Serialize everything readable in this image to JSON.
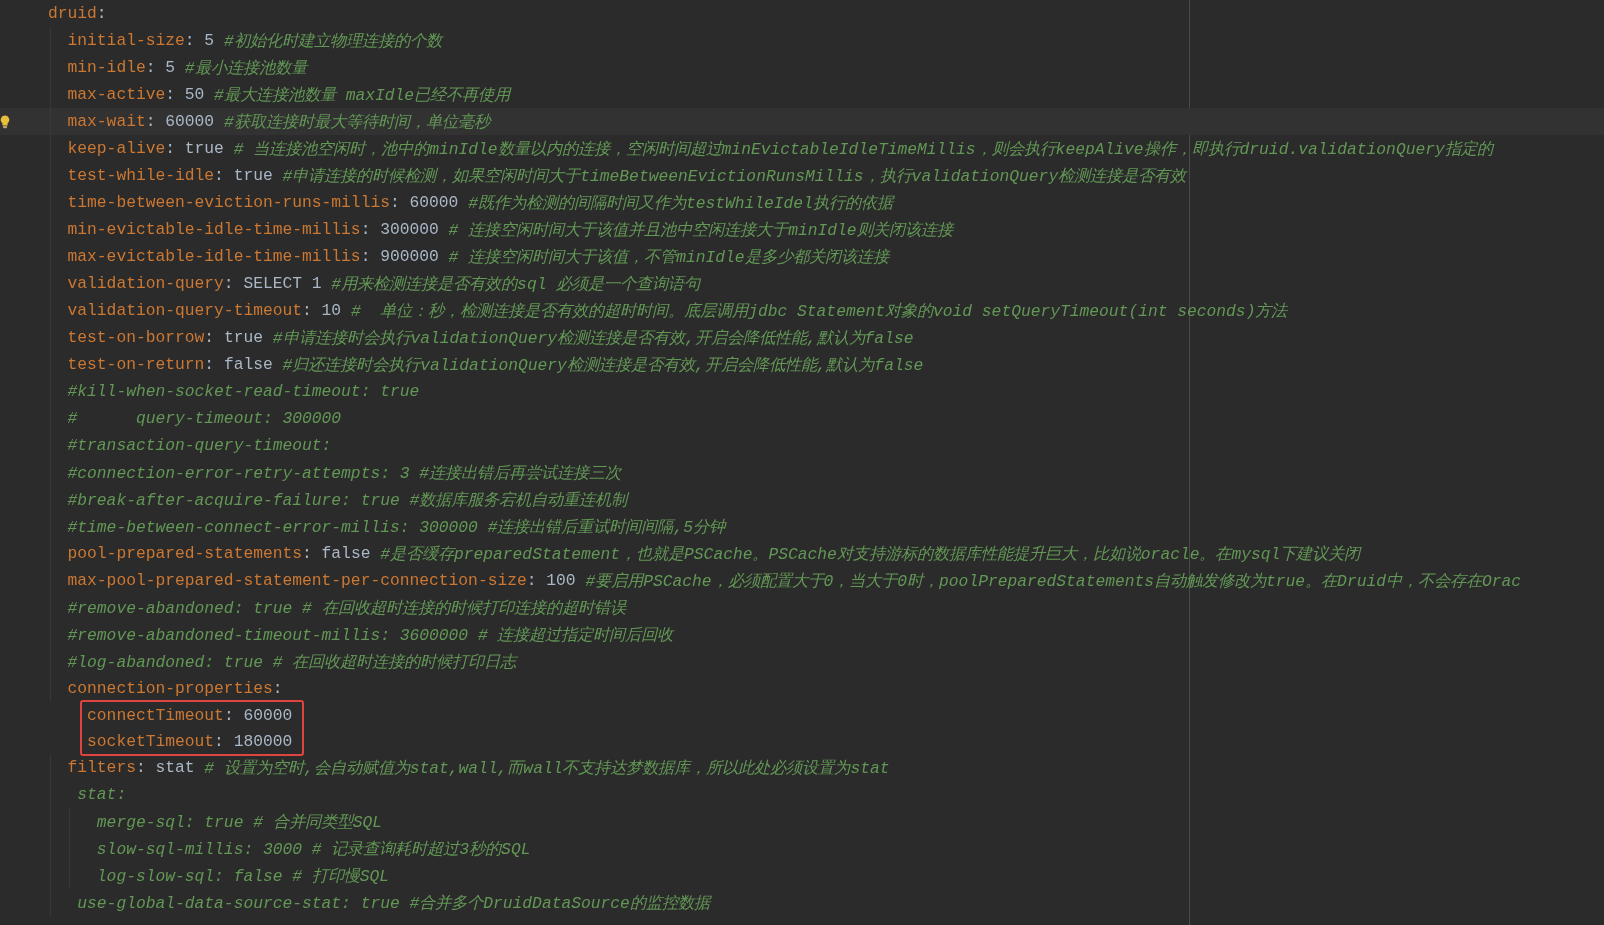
{
  "editor": {
    "lines": [
      {
        "current": false,
        "hint": false,
        "tokens": [
          {
            "kind": "key",
            "text": "druid"
          },
          {
            "kind": "colon",
            "text": ":"
          }
        ],
        "children_boxed": false,
        "children": [
          {
            "current": false,
            "hint": false,
            "tokens": [
              {
                "kind": "key",
                "text": "initial-size"
              },
              {
                "kind": "colon",
                "text": ":"
              },
              {
                "kind": "value",
                "text": "5"
              },
              {
                "kind": "comment",
                "text": "#初始化时建立物理连接的个数"
              }
            ]
          },
          {
            "current": false,
            "hint": false,
            "tokens": [
              {
                "kind": "key",
                "text": "min-idle"
              },
              {
                "kind": "colon",
                "text": ":"
              },
              {
                "kind": "value",
                "text": "5"
              },
              {
                "kind": "comment",
                "text": "#最小连接池数量"
              }
            ]
          },
          {
            "current": false,
            "hint": false,
            "tokens": [
              {
                "kind": "key",
                "text": "max-active"
              },
              {
                "kind": "colon",
                "text": ":"
              },
              {
                "kind": "value",
                "text": "50"
              },
              {
                "kind": "comment",
                "text": "#最大连接池数量 maxIdle已经不再使用"
              }
            ]
          },
          {
            "current": true,
            "hint": true,
            "tokens": [
              {
                "kind": "key",
                "text": "max-wait"
              },
              {
                "kind": "colon",
                "text": ":"
              },
              {
                "kind": "value",
                "text": "60000"
              },
              {
                "kind": "comment",
                "text": "#获取连接时最大等待时间，单位毫秒"
              }
            ]
          },
          {
            "current": false,
            "hint": false,
            "tokens": [
              {
                "kind": "key",
                "text": "keep-alive"
              },
              {
                "kind": "colon",
                "text": ":"
              },
              {
                "kind": "value",
                "text": "true"
              },
              {
                "kind": "comment",
                "text": "# 当连接池空闲时，池中的minIdle数量以内的连接，空闲时间超过minEvictableIdleTimeMillis，则会执行keepAlive操作，即执行druid.validationQuery指定的"
              }
            ]
          },
          {
            "current": false,
            "hint": false,
            "tokens": [
              {
                "kind": "key",
                "text": "test-while-idle"
              },
              {
                "kind": "colon",
                "text": ":"
              },
              {
                "kind": "value",
                "text": "true"
              },
              {
                "kind": "comment",
                "text": "#申请连接的时候检测，如果空闲时间大于timeBetweenEvictionRunsMillis，执行validationQuery检测连接是否有效"
              }
            ]
          },
          {
            "current": false,
            "hint": false,
            "tokens": [
              {
                "kind": "key",
                "text": "time-between-eviction-runs-millis"
              },
              {
                "kind": "colon",
                "text": ":"
              },
              {
                "kind": "value",
                "text": "60000"
              },
              {
                "kind": "comment",
                "text": "#既作为检测的间隔时间又作为testWhileIdel执行的依据"
              }
            ]
          },
          {
            "current": false,
            "hint": false,
            "tokens": [
              {
                "kind": "key",
                "text": "min-evictable-idle-time-millis"
              },
              {
                "kind": "colon",
                "text": ":"
              },
              {
                "kind": "value",
                "text": "300000"
              },
              {
                "kind": "comment",
                "text": "# 连接空闲时间大于该值并且池中空闲连接大于minIdle则关闭该连接"
              }
            ]
          },
          {
            "current": false,
            "hint": false,
            "tokens": [
              {
                "kind": "key",
                "text": "max-evictable-idle-time-millis"
              },
              {
                "kind": "colon",
                "text": ":"
              },
              {
                "kind": "value",
                "text": "900000"
              },
              {
                "kind": "comment",
                "text": "# 连接空闲时间大于该值，不管minIdle是多少都关闭该连接"
              }
            ]
          },
          {
            "current": false,
            "hint": false,
            "tokens": [
              {
                "kind": "key",
                "text": "validation-query"
              },
              {
                "kind": "colon",
                "text": ":"
              },
              {
                "kind": "value",
                "text": "SELECT 1"
              },
              {
                "kind": "comment",
                "text": "#用来检测连接是否有效的sql 必须是一个查询语句"
              }
            ]
          },
          {
            "current": false,
            "hint": false,
            "tokens": [
              {
                "kind": "key",
                "text": "validation-query-timeout"
              },
              {
                "kind": "colon",
                "text": ":"
              },
              {
                "kind": "value",
                "text": "10"
              },
              {
                "kind": "comment",
                "text": "#  单位：秒，检测连接是否有效的超时时间。底层调用jdbc Statement对象的void setQueryTimeout(int seconds)方法"
              }
            ]
          },
          {
            "current": false,
            "hint": false,
            "tokens": [
              {
                "kind": "key",
                "text": "test-on-borrow"
              },
              {
                "kind": "colon",
                "text": ":"
              },
              {
                "kind": "value",
                "text": "true"
              },
              {
                "kind": "comment",
                "text": "#申请连接时会执行validationQuery检测连接是否有效,开启会降低性能,默认为false"
              }
            ]
          },
          {
            "current": false,
            "hint": false,
            "tokens": [
              {
                "kind": "key",
                "text": "test-on-return"
              },
              {
                "kind": "colon",
                "text": ":"
              },
              {
                "kind": "value",
                "text": "false"
              },
              {
                "kind": "comment",
                "text": "#归还连接时会执行validationQuery检测连接是否有效,开启会降低性能,默认为false"
              }
            ]
          },
          {
            "current": false,
            "hint": false,
            "tokens": [
              {
                "kind": "comment",
                "text": "#kill-when-socket-read-timeout: true"
              }
            ]
          },
          {
            "current": false,
            "hint": false,
            "tokens": [
              {
                "kind": "comment",
                "text": "#      query-timeout: 300000"
              }
            ]
          },
          {
            "current": false,
            "hint": false,
            "tokens": [
              {
                "kind": "comment",
                "text": "#transaction-query-timeout:"
              }
            ]
          },
          {
            "current": false,
            "hint": false,
            "tokens": [
              {
                "kind": "comment",
                "text": "#connection-error-retry-attempts: 3 #连接出错后再尝试连接三次"
              }
            ]
          },
          {
            "current": false,
            "hint": false,
            "tokens": [
              {
                "kind": "comment",
                "text": "#break-after-acquire-failure: true #数据库服务宕机自动重连机制"
              }
            ]
          },
          {
            "current": false,
            "hint": false,
            "tokens": [
              {
                "kind": "comment",
                "text": "#time-between-connect-error-millis: 300000 #连接出错后重试时间间隔,5分钟"
              }
            ]
          },
          {
            "current": false,
            "hint": false,
            "tokens": [
              {
                "kind": "key",
                "text": "pool-prepared-statements"
              },
              {
                "kind": "colon",
                "text": ":"
              },
              {
                "kind": "value",
                "text": "false"
              },
              {
                "kind": "comment",
                "text": "#是否缓存preparedStatement，也就是PSCache。PSCache对支持游标的数据库性能提升巨大，比如说oracle。在mysql下建议关闭"
              }
            ]
          },
          {
            "current": false,
            "hint": false,
            "tokens": [
              {
                "kind": "key",
                "text": "max-pool-prepared-statement-per-connection-size"
              },
              {
                "kind": "colon",
                "text": ":"
              },
              {
                "kind": "value",
                "text": "100"
              },
              {
                "kind": "comment",
                "text": "#要启用PSCache，必须配置大于0，当大于0时，poolPreparedStatements自动触发修改为true。在Druid中，不会存在Orac"
              }
            ]
          },
          {
            "current": false,
            "hint": false,
            "tokens": [
              {
                "kind": "comment",
                "text": "#remove-abandoned: true # 在回收超时连接的时候打印连接的超时错误"
              }
            ]
          },
          {
            "current": false,
            "hint": false,
            "tokens": [
              {
                "kind": "comment",
                "text": "#remove-abandoned-timeout-millis: 3600000 # 连接超过指定时间后回收"
              }
            ]
          },
          {
            "current": false,
            "hint": false,
            "tokens": [
              {
                "kind": "comment",
                "text": "#log-abandoned: true # 在回收超时连接的时候打印日志"
              }
            ]
          },
          {
            "current": false,
            "hint": false,
            "tokens": [
              {
                "kind": "key",
                "text": "connection-properties"
              },
              {
                "kind": "colon",
                "text": ":"
              }
            ],
            "children_boxed": true,
            "children": [
              {
                "tokens": [
                  {
                    "kind": "key",
                    "text": "connectTimeout"
                  },
                  {
                    "kind": "colon",
                    "text": ":"
                  },
                  {
                    "kind": "value",
                    "text": "60000"
                  }
                ]
              },
              {
                "tokens": [
                  {
                    "kind": "key",
                    "text": "socketTimeout"
                  },
                  {
                    "kind": "colon",
                    "text": ":"
                  },
                  {
                    "kind": "value",
                    "text": "180000"
                  }
                ]
              }
            ]
          },
          {
            "current": false,
            "hint": false,
            "tokens": [
              {
                "kind": "key",
                "text": "filters"
              },
              {
                "kind": "colon",
                "text": ":"
              },
              {
                "kind": "value",
                "text": "stat"
              },
              {
                "kind": "comment",
                "text": "# 设置为空时,会自动赋值为stat,wall,而wall不支持达梦数据库，所以此处必须设置为stat"
              }
            ]
          },
          {
            "current": false,
            "hint": false,
            "tokens": [
              {
                "kind": "comment",
                "text": " stat:"
              }
            ],
            "children_boxed": false,
            "children": [
              {
                "current": false,
                "hint": false,
                "tokens": [
                  {
                    "kind": "comment",
                    "text": " merge-sql: true # 合并同类型SQL"
                  }
                ]
              },
              {
                "current": false,
                "hint": false,
                "tokens": [
                  {
                    "kind": "comment",
                    "text": " slow-sql-millis: 3000 # 记录查询耗时超过3秒的SQL"
                  }
                ]
              },
              {
                "current": false,
                "hint": false,
                "tokens": [
                  {
                    "kind": "comment",
                    "text": " log-slow-sql: false # 打印慢SQL"
                  }
                ]
              }
            ]
          },
          {
            "current": false,
            "hint": false,
            "tokens": [
              {
                "kind": "comment",
                "text": " use-global-data-source-stat: true #合并多个DruidDataSource的监控数据"
              }
            ]
          }
        ]
      }
    ]
  }
}
